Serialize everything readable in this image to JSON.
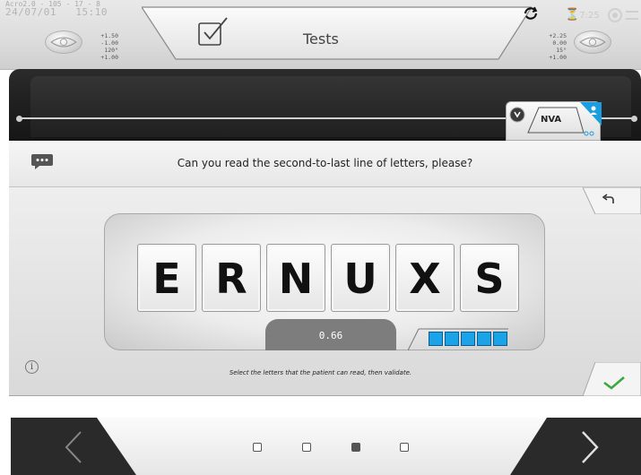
{
  "status": {
    "line1": "Acro2.0 - 105 - 17 - 8",
    "date": "24/07/01",
    "time": "15:10",
    "timer": "7:25"
  },
  "header": {
    "title": "Tests",
    "left_rx": [
      "+1.50",
      "-1.00",
      "120°",
      "+1.00"
    ],
    "right_rx": [
      "+2.25",
      "0.00",
      "15°",
      "+1.00"
    ]
  },
  "test_strip": {
    "active_test": "NVA"
  },
  "question": {
    "text": "Can you read the second-to-last line of letters, please?"
  },
  "chart": {
    "letters": [
      "E",
      "R",
      "N",
      "U",
      "X",
      "S"
    ],
    "acuity": "0.66",
    "score_blocks": 5
  },
  "hint": {
    "text": "Select the letters that the patient can read, then validate."
  },
  "pager": {
    "pages": 4,
    "active_index": 2
  },
  "colors": {
    "accent_blue": "#1aa3e6",
    "validate_green": "#3aa83a"
  }
}
